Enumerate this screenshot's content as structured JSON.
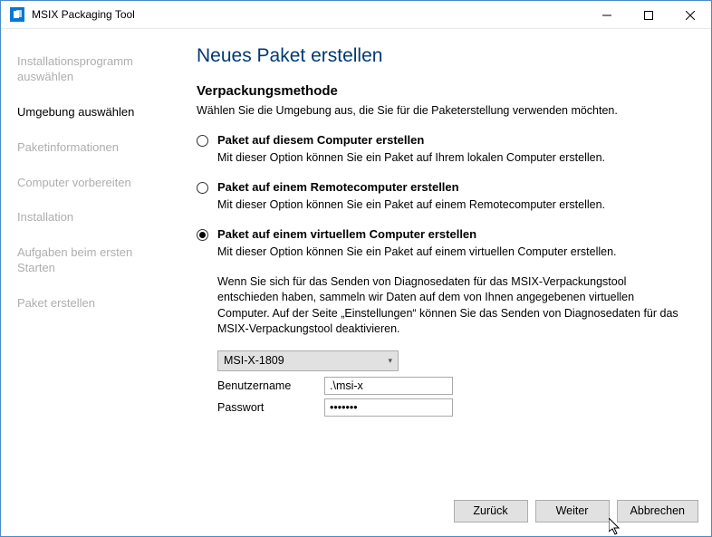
{
  "titlebar": {
    "title": "MSIX Packaging Tool"
  },
  "sidebar": {
    "items": [
      {
        "label": "Installationsprogramm auswählen"
      },
      {
        "label": "Umgebung auswählen"
      },
      {
        "label": "Paketinformationen"
      },
      {
        "label": "Computer vorbereiten"
      },
      {
        "label": "Installation"
      },
      {
        "label": "Aufgaben beim ersten Starten"
      },
      {
        "label": "Paket erstellen"
      }
    ],
    "activeIndex": 1
  },
  "main": {
    "pageTitle": "Neues Paket erstellen",
    "sectionTitle": "Verpackungsmethode",
    "sectionSub": "Wählen Sie die Umgebung aus, die Sie für die Paketerstellung verwenden möchten.",
    "options": [
      {
        "label": "Paket auf diesem Computer erstellen",
        "desc": "Mit dieser Option können Sie ein Paket auf Ihrem lokalen Computer erstellen.",
        "checked": false
      },
      {
        "label": "Paket auf einem Remotecomputer erstellen",
        "desc": "Mit dieser Option können Sie ein Paket auf einem Remotecomputer erstellen.",
        "checked": false
      },
      {
        "label": "Paket auf einem virtuellem Computer erstellen",
        "desc": "Mit dieser Option können Sie ein Paket auf einem virtuellen Computer erstellen.",
        "checked": true,
        "note": "Wenn Sie sich für das Senden von Diagnosedaten für das MSIX-Verpackungstool entschieden haben, sammeln wir Daten auf dem von Ihnen angegebenen virtuellen Computer. Auf der Seite „Einstellungen“ können Sie das Senden von Diagnosedaten für das MSIX-Verpackungstool deaktivieren."
      }
    ],
    "vmSelect": "MSI-X-1809",
    "userLabel": "Benutzername",
    "userValue": ".\\msi-x",
    "passLabel": "Passwort",
    "passValue": "•••••••"
  },
  "footer": {
    "back": "Zurück",
    "next": "Weiter",
    "cancel": "Abbrechen"
  }
}
